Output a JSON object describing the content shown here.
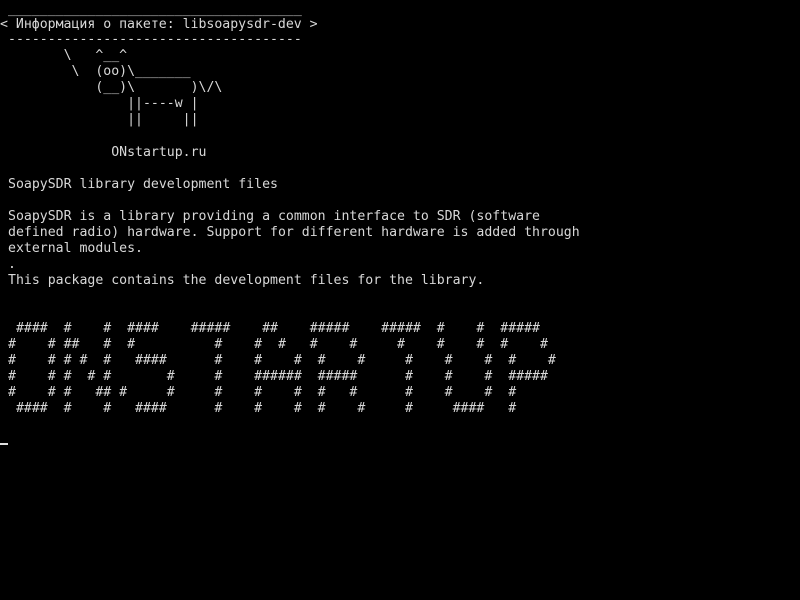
{
  "console": {
    "header_rule_top": "_____________________________________",
    "header_title": "< Информация о пакете: libsoapysdr-dev >",
    "header_rule_bottom": "-------------------------------------",
    "cow_art": [
      "       \\   ^__^",
      "        \\  (oo)\\_______",
      "           (__)\\       )\\/\\",
      "               ||----w |",
      "               ||     ||"
    ],
    "site_label": "             ONstartup.ru",
    "package_summary": "SoapySDR library development files",
    "description_lines": [
      "SoapySDR is a library providing a common interface to SDR (software",
      "defined radio) hardware. Support for different hardware is added through",
      "external modules.",
      ".",
      "This package contains the development files for the library."
    ],
    "banner_lines": [
      " ####  #    #  ####    #####    ##    #####    #####  #    #  #####",
      "#    # ##   #  #          #    #  #   #    #     #    #    #  #    #",
      "#    # # #  #   ####      #    #    #  #    #     #    #    #  #    #",
      "#    # #  # #       #     #    ######  #####      #    #    #  #####",
      "#    # #   ## #     #     #    #    #  #   #      #    #    #  #",
      " ####  #    #   ####      #    #    #  #    #     #     ####   #"
    ]
  }
}
